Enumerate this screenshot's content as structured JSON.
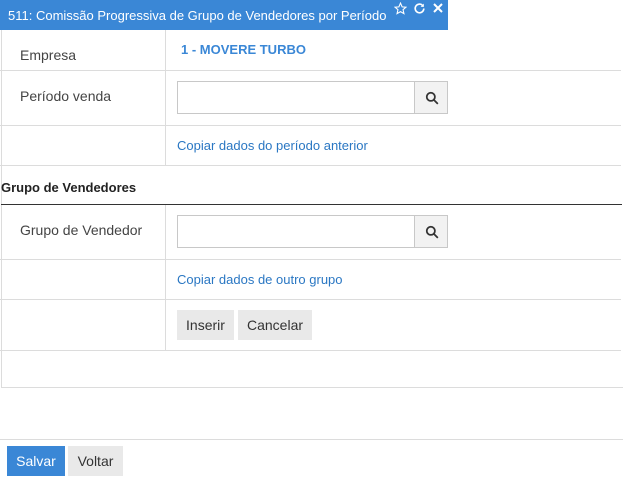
{
  "window": {
    "title": "511: Comissão Progressiva de Grupo de Vendedores por Período",
    "icons": [
      "star-icon",
      "refresh-icon",
      "close-icon"
    ],
    "accent_color": "#3a87d6"
  },
  "form": {
    "empresa_label": "Empresa",
    "empresa_value": "1 - MOVERE TURBO",
    "periodo_label": "Período venda",
    "periodo_value": "",
    "copiar_periodo_link": "Copiar dados do período anterior"
  },
  "section": {
    "title": "Grupo de Vendedores",
    "grupo_label": "Grupo de Vendedor",
    "grupo_value": "",
    "copiar_grupo_link": "Copiar dados de outro grupo",
    "inserir_label": "Inserir",
    "cancelar_label": "Cancelar"
  },
  "footer": {
    "salvar_label": "Salvar",
    "voltar_label": "Voltar"
  }
}
